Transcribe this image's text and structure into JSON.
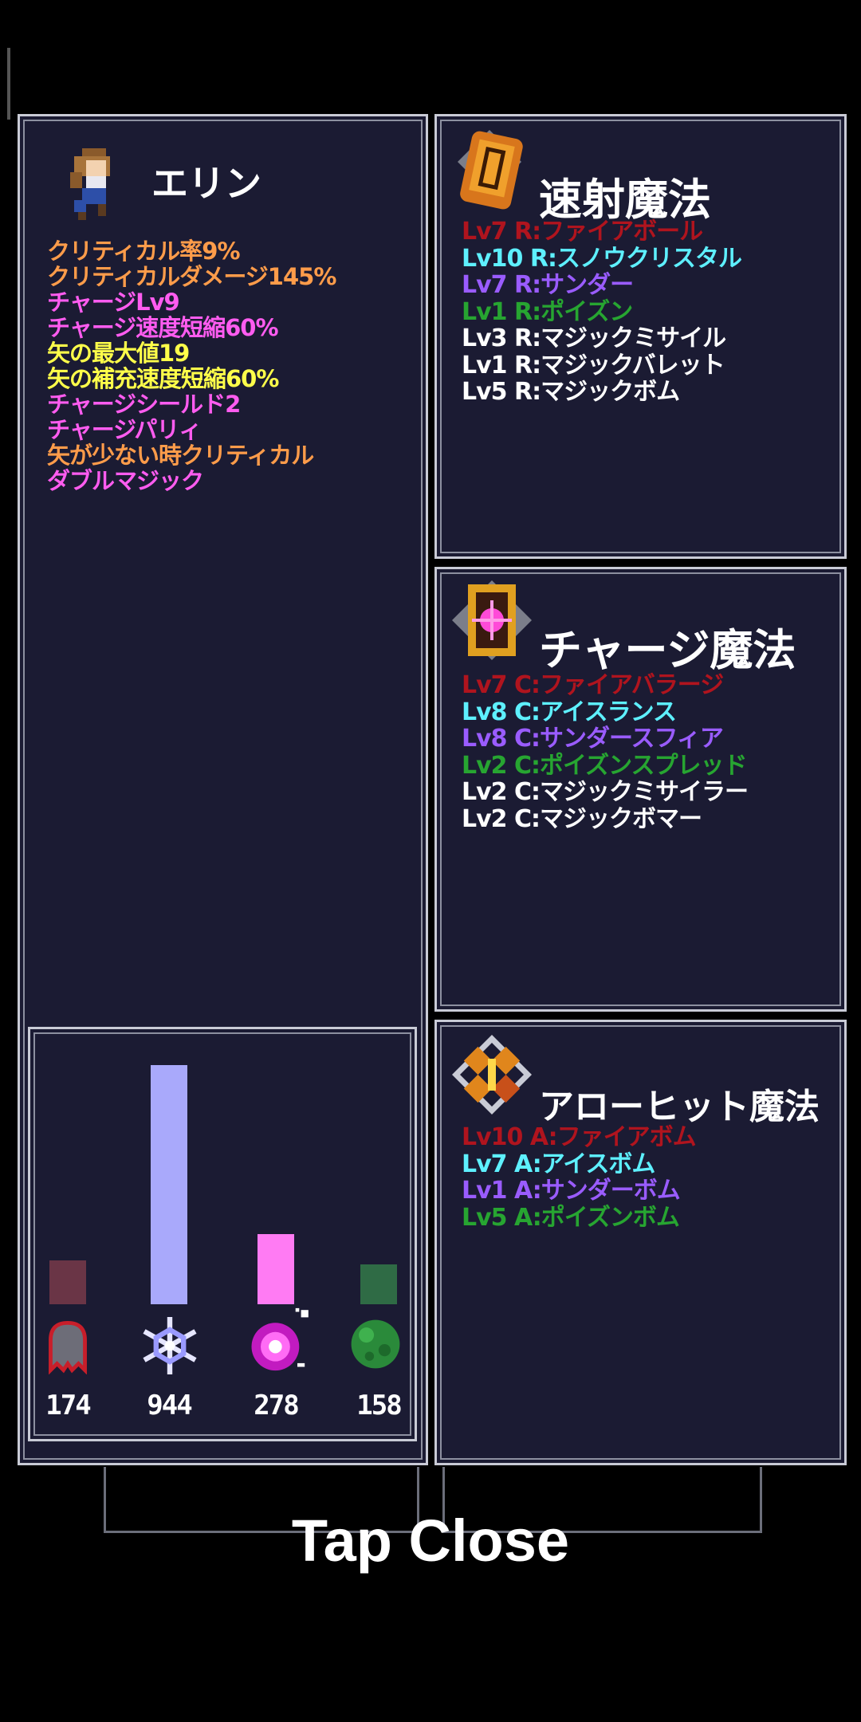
{
  "character": {
    "name": "エリン",
    "stats": [
      {
        "text": "クリティカル率9%",
        "color": "#ff9c4a"
      },
      {
        "text": "クリティカルダメージ145%",
        "color": "#ff9c4a"
      },
      {
        "text": "チャージLv9",
        "color": "#ff5cf0"
      },
      {
        "text": "チャージ速度短縮60%",
        "color": "#ff5cf0"
      },
      {
        "text": "矢の最大値19",
        "color": "#ffff4a"
      },
      {
        "text": "矢の補充速度短縮60%",
        "color": "#ffff4a"
      },
      {
        "text": "チャージシールド2",
        "color": "#ff5cf0"
      },
      {
        "text": "チャージパリィ",
        "color": "#ff5cf0"
      },
      {
        "text": "矢が少ない時クリティカル",
        "color": "#ff9c4a"
      },
      {
        "text": "ダブルマジック",
        "color": "#ff5cf0"
      }
    ]
  },
  "chart_data": {
    "type": "bar",
    "categories": [
      "fire",
      "ice",
      "thunder",
      "poison"
    ],
    "values": [
      174,
      944,
      278,
      158
    ],
    "colors": [
      "#6a3546",
      "#a9a9fb",
      "#ff7bf3",
      "#2f6b45"
    ],
    "icons": [
      "ghost-icon",
      "snowflake-icon",
      "magic-orb-icon",
      "slime-icon"
    ],
    "labels": [
      "174",
      "944",
      "278",
      "158"
    ]
  },
  "rapid_magic": {
    "title": "速射魔法",
    "lines": [
      {
        "text": "Lv7 R:ファイアボール",
        "color": "#b0141e"
      },
      {
        "text": "Lv10 R:スノウクリスタル",
        "color": "#5ef0ff"
      },
      {
        "text": "Lv7 R:サンダー",
        "color": "#9a5cff"
      },
      {
        "text": "Lv1 R:ポイズン",
        "color": "#27a531"
      },
      {
        "text": "Lv3 R:マジックミサイル",
        "color": "#ffffff"
      },
      {
        "text": "Lv1 R:マジックバレット",
        "color": "#ffffff"
      },
      {
        "text": "Lv5 R:マジックボム",
        "color": "#ffffff"
      }
    ]
  },
  "charge_magic": {
    "title": "チャージ魔法",
    "lines": [
      {
        "text": "Lv7 C:ファイアバラージ",
        "color": "#b0141e"
      },
      {
        "text": "Lv8 C:アイスランス",
        "color": "#5ef0ff"
      },
      {
        "text": "Lv8 C:サンダースフィア",
        "color": "#9a5cff"
      },
      {
        "text": "Lv2 C:ポイズンスプレッド",
        "color": "#27a531"
      },
      {
        "text": "Lv2 C:マジックミサイラー",
        "color": "#ffffff"
      },
      {
        "text": "Lv2 C:マジックボマー",
        "color": "#ffffff"
      }
    ]
  },
  "arrowhit_magic": {
    "title": "アローヒット魔法",
    "lines": [
      {
        "text": "Lv10 A:ファイアボム",
        "color": "#b0141e"
      },
      {
        "text": "Lv7 A:アイスボム",
        "color": "#5ef0ff"
      },
      {
        "text": "Lv1 A:サンダーボム",
        "color": "#9a5cff"
      },
      {
        "text": "Lv5 A:ポイズンボム",
        "color": "#27a531"
      }
    ]
  },
  "close_label": "Tap Close"
}
